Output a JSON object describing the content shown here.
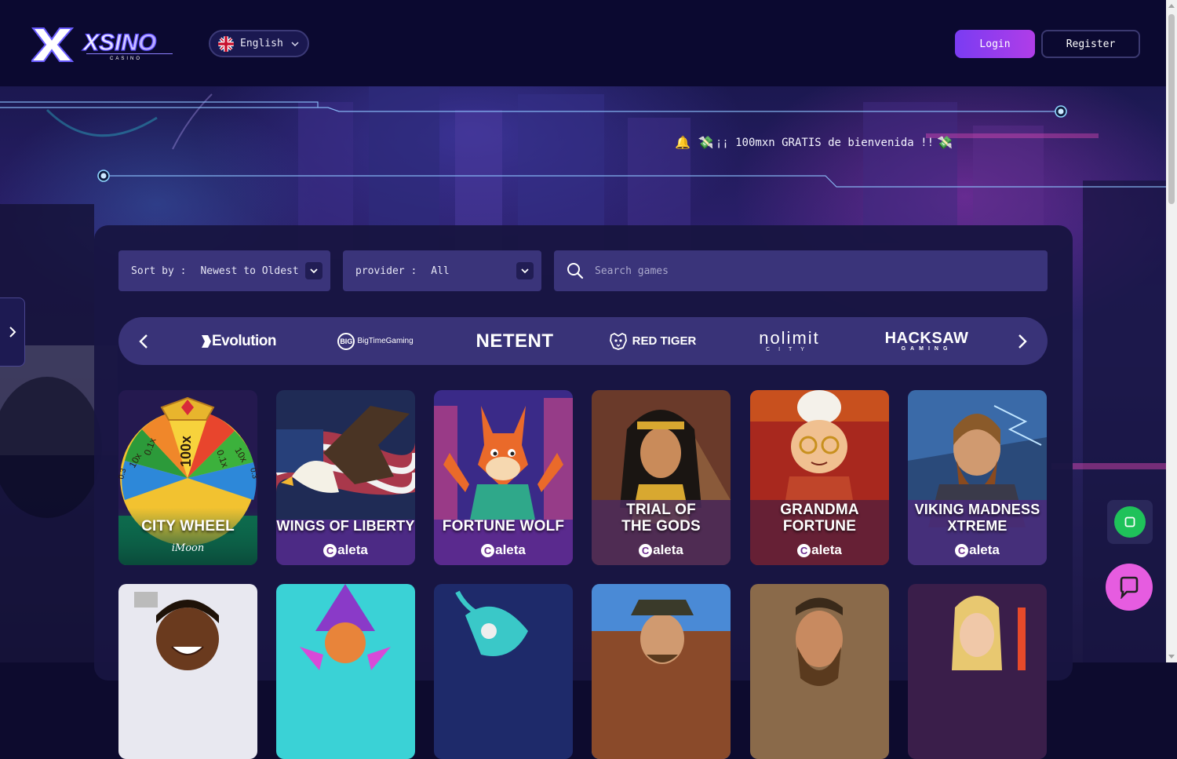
{
  "header": {
    "logo_text": "XSINO",
    "logo_subtext": "CASINO",
    "language": {
      "label": "English",
      "flag_icon": "uk-flag-icon"
    },
    "login_label": "Login",
    "register_label": "Register"
  },
  "hero": {
    "marquee_text": "¡¡ 100mxn GRATIS de bienvenida !!",
    "marquee_lead_emoji": "🔔",
    "marquee_emoji": "💸"
  },
  "filters": {
    "sort_label": "Sort by :",
    "sort_value": "Newest to Oldest",
    "provider_label": "provider :",
    "provider_value": "All",
    "search_placeholder": "Search games"
  },
  "providers": [
    {
      "name": "Evolution"
    },
    {
      "name": "BigTimeGaming",
      "badge": "BIG"
    },
    {
      "name": "NETENT"
    },
    {
      "name": "RED TIGER"
    },
    {
      "name": "nolimit",
      "sub": "CITY"
    },
    {
      "name": "HACKSAW",
      "sub": "GAMING"
    }
  ],
  "games_row1": [
    {
      "title": "CITY WHEEL",
      "brand": "iMoon"
    },
    {
      "title": "WINGS OF LIBERTY",
      "brand": "aleta"
    },
    {
      "title": "FORTUNE WOLF",
      "brand": "aleta"
    },
    {
      "title_line1": "TRIAL OF",
      "title_line2": "THE GODS",
      "brand": "aleta"
    },
    {
      "title_line1": "GRANDMA",
      "title_line2": "FORTUNE",
      "brand": "aleta"
    },
    {
      "title_line1": "VIKING MADNESS",
      "title_line2": "XTREME",
      "brand": "aleta"
    }
  ],
  "city_wheel_segments": [
    "10x",
    "0.1x",
    "100x",
    "0.1x",
    "10x",
    "0.3",
    "0.3"
  ],
  "colors": {
    "accent": "#9b3df0",
    "background": "#0d0b2e",
    "panel": "#181542",
    "chat": "#e65ce0",
    "green": "#1fc25a"
  }
}
